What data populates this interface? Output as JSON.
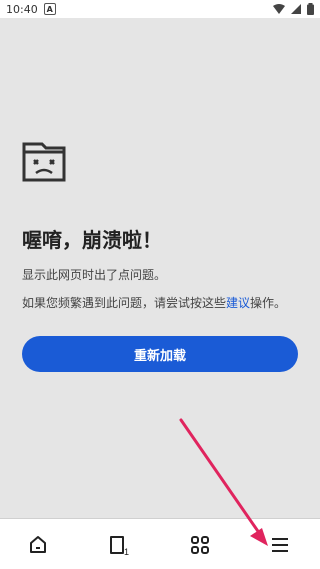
{
  "status_bar": {
    "time": "10:40",
    "notification_icon": "A"
  },
  "error_page": {
    "title": "喔唷，崩溃啦！",
    "desc1": "显示此网页时出了点问题。",
    "desc2_prefix": "如果您频繁遇到此问题，请尝试按这些",
    "desc2_link": "建议",
    "desc2_suffix": "操作。",
    "reload_button": "重新加载"
  },
  "bottom_nav": {
    "items": [
      "home-icon",
      "tabs-icon",
      "apps-grid-icon",
      "menu-icon"
    ],
    "tab_count": "1"
  },
  "colors": {
    "accent": "#1a5bd6",
    "arrow": "#e0245e"
  }
}
